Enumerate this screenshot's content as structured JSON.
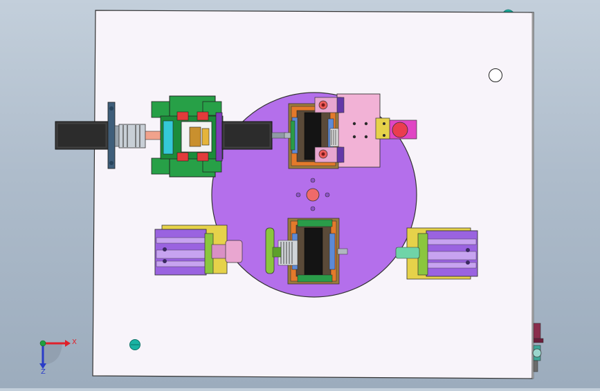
{
  "viewport": {
    "background_top": "#c3cfdb",
    "background_bottom": "#9cacbd"
  },
  "model": {
    "base_plate_color": "#f7f3fa",
    "turntable_color": "#b073ea",
    "edge_color": "#333333"
  },
  "triad": {
    "x_label": "X",
    "z_label": "Z",
    "x_color": "#e0202a",
    "z_color": "#2a3cc8",
    "y_color": "#20a040"
  },
  "icons": {
    "triad": "coordinate-axes-icon"
  }
}
